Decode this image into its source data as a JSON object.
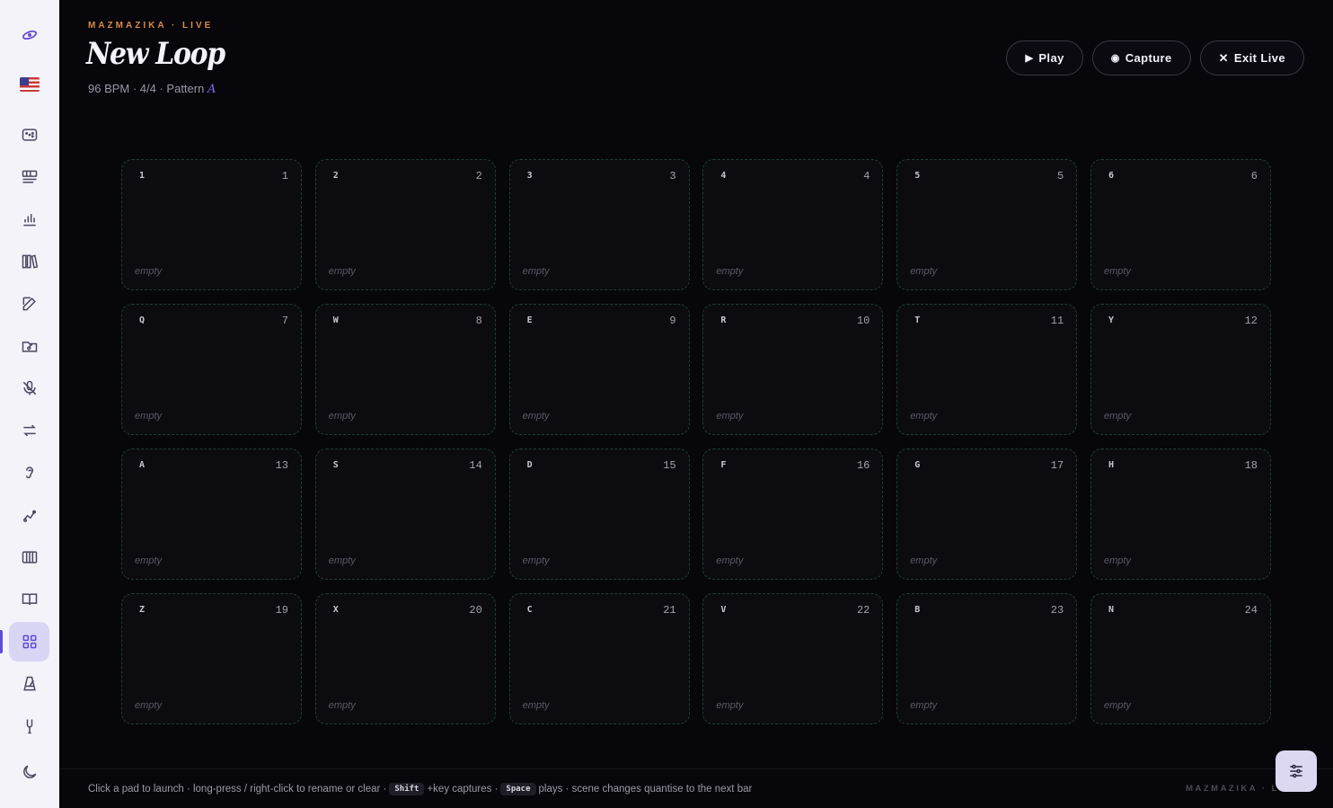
{
  "header": {
    "brand": "MAZMAZIKA · LIVE",
    "title": "New Loop",
    "subtitle": "96 BPM · 4/4 · Pattern",
    "subtitle_accent": "A"
  },
  "actions": {
    "play": "Play",
    "capture": "Capture",
    "exit": "Exit Live"
  },
  "pads": [
    {
      "key": "1",
      "num": "1",
      "state": "empty"
    },
    {
      "key": "2",
      "num": "2",
      "state": "empty"
    },
    {
      "key": "3",
      "num": "3",
      "state": "empty"
    },
    {
      "key": "4",
      "num": "4",
      "state": "empty"
    },
    {
      "key": "5",
      "num": "5",
      "state": "empty"
    },
    {
      "key": "6",
      "num": "6",
      "state": "empty"
    },
    {
      "key": "Q",
      "num": "7",
      "state": "empty"
    },
    {
      "key": "W",
      "num": "8",
      "state": "empty"
    },
    {
      "key": "E",
      "num": "9",
      "state": "empty"
    },
    {
      "key": "R",
      "num": "10",
      "state": "empty"
    },
    {
      "key": "T",
      "num": "11",
      "state": "empty"
    },
    {
      "key": "Y",
      "num": "12",
      "state": "empty"
    },
    {
      "key": "A",
      "num": "13",
      "state": "empty"
    },
    {
      "key": "S",
      "num": "14",
      "state": "empty"
    },
    {
      "key": "D",
      "num": "15",
      "state": "empty"
    },
    {
      "key": "F",
      "num": "16",
      "state": "empty"
    },
    {
      "key": "G",
      "num": "17",
      "state": "empty"
    },
    {
      "key": "H",
      "num": "18",
      "state": "empty"
    },
    {
      "key": "Z",
      "num": "19",
      "state": "empty"
    },
    {
      "key": "X",
      "num": "20",
      "state": "empty"
    },
    {
      "key": "C",
      "num": "21",
      "state": "empty"
    },
    {
      "key": "V",
      "num": "22",
      "state": "empty"
    },
    {
      "key": "B",
      "num": "23",
      "state": "empty"
    },
    {
      "key": "N",
      "num": "24",
      "state": "empty"
    }
  ],
  "footer": {
    "part1": "Click a pad to launch · long-press / right-click to rename or clear ·",
    "kbd_shift": "Shift",
    "part2": "+key captures ·",
    "kbd_space": "Space",
    "part3": "plays · scene changes quantise to the next bar",
    "brand": "MAZMAZIKA · L"
  },
  "sidebar": {
    "items": [
      {
        "name": "logo-icon"
      },
      {
        "name": "us-flag-icon"
      },
      {
        "name": "gamepad-icon"
      },
      {
        "name": "keyboard-stack-icon"
      },
      {
        "name": "bar-chart-icon"
      },
      {
        "name": "library-icon"
      },
      {
        "name": "edit-icon"
      },
      {
        "name": "folder-music-icon"
      },
      {
        "name": "microphone-off-icon"
      },
      {
        "name": "swap-arrows-icon"
      },
      {
        "name": "ear-icon"
      },
      {
        "name": "melody-icon"
      },
      {
        "name": "piano-icon"
      },
      {
        "name": "book-open-icon"
      },
      {
        "name": "grid-icon"
      },
      {
        "name": "metronome-icon"
      },
      {
        "name": "tuning-fork-icon"
      },
      {
        "name": "moon-icon"
      }
    ]
  },
  "colors": {
    "accent": "#7c6cf0",
    "brand": "#d98a4a",
    "active_bg": "#d9d5f4"
  }
}
